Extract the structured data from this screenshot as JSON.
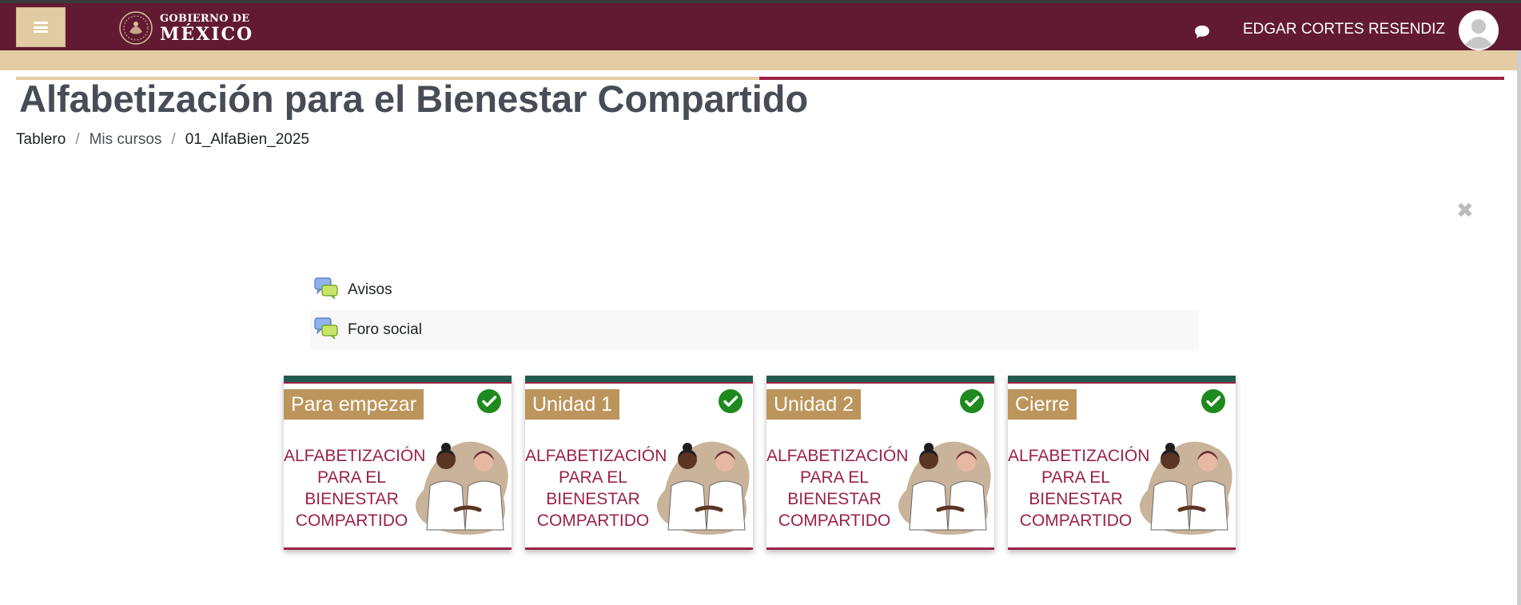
{
  "header": {
    "menu_icon": "hamburger-icon",
    "logo": {
      "line1": "GOBIERNO DE",
      "line2": "MÉXICO"
    },
    "messages_icon": "chat-bubble-icon",
    "user_name": "EDGAR CORTES RESENDIZ",
    "avatar_icon": "user-avatar-icon"
  },
  "page": {
    "title": "Alfabetización para el Bienestar Compartido",
    "breadcrumb": [
      {
        "label": "Tablero"
      },
      {
        "label": "Mis cursos"
      },
      {
        "label": "01_AlfaBien_2025"
      }
    ],
    "close_icon": "close-icon"
  },
  "activities": [
    {
      "label": "Avisos",
      "icon": "forum-icon"
    },
    {
      "label": "Foro social",
      "icon": "forum-icon"
    }
  ],
  "sections": [
    {
      "label": "Para empezar",
      "status_icon": "check-circle-icon",
      "image_text": "ALFABETIZACIÓN\nPARA EL\nBIENESTAR\nCOMPARTIDO"
    },
    {
      "label": "Unidad 1",
      "status_icon": "check-circle-icon",
      "image_text": "ALFABETIZACIÓN\nPARA EL\nBIENESTAR\nCOMPARTIDO"
    },
    {
      "label": "Unidad 2",
      "status_icon": "check-circle-icon",
      "image_text": "ALFABETIZACIÓN\nPARA EL\nBIENESTAR\nCOMPARTIDO"
    },
    {
      "label": "Cierre",
      "status_icon": "check-circle-icon",
      "image_text": "ALFABETIZACIÓN\nPARA EL\nBIENESTAR\nCOMPARTIDO"
    }
  ],
  "colors": {
    "navbar": "#621a33",
    "accent_gold": "#bc955c",
    "accent_sand": "#e4cda5",
    "accent_wine": "#9b2247",
    "card_top": "#235b4e",
    "check_green": "#1e8a1e"
  }
}
